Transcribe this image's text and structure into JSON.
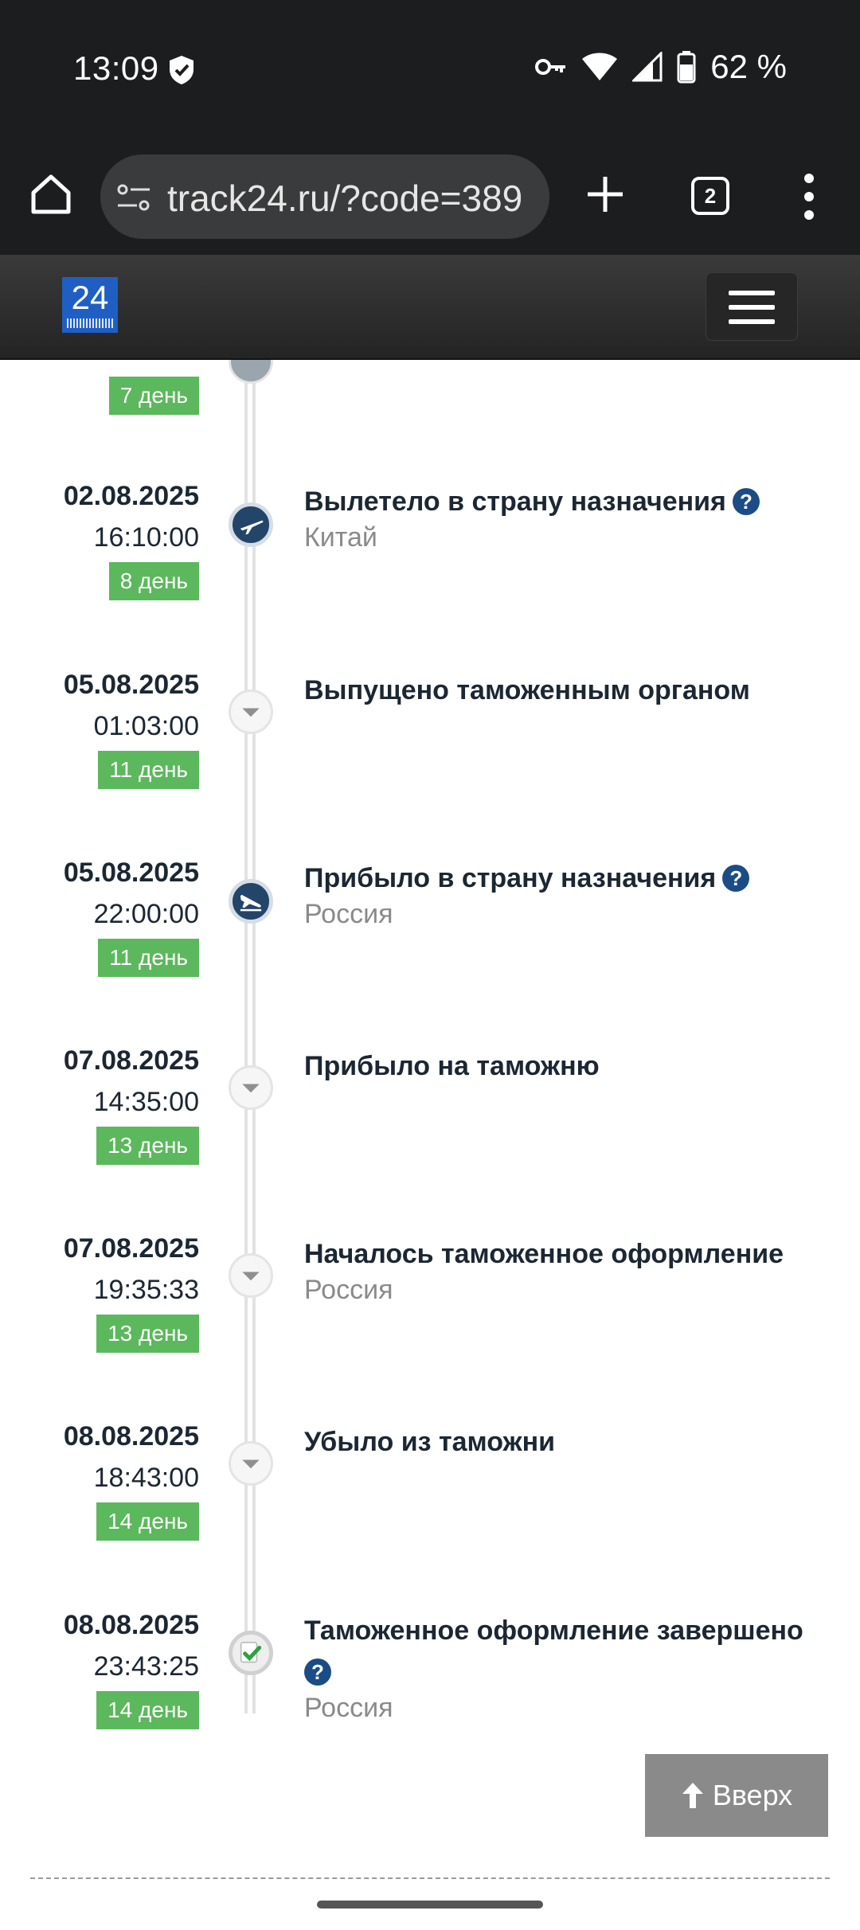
{
  "status_bar": {
    "time": "13:09",
    "battery": "62 %",
    "icons": [
      "shield-icon",
      "vpn-key-icon",
      "wifi-icon",
      "signal-icon",
      "battery-icon"
    ]
  },
  "browser": {
    "url": "track24.ru/?code=389",
    "tab_count": "2",
    "icons": [
      "home-icon",
      "site-settings-icon",
      "new-tab-icon",
      "tabs-icon",
      "overflow-menu-icon"
    ]
  },
  "site": {
    "logo_text": "24",
    "menu_icon": "hamburger-icon"
  },
  "timeline": {
    "partial_top": {
      "day": "7 день"
    },
    "events": [
      {
        "date": "02.08.2025",
        "time": "16:10:00",
        "day": "8 день",
        "title": "Вылетело в страну назначения",
        "help": "?",
        "place": "Китай",
        "icon": "plane-departure-icon"
      },
      {
        "date": "05.08.2025",
        "time": "01:03:00",
        "day": "11 день",
        "title": "Выпущено таможенным органом",
        "help": "",
        "place": "",
        "icon": "arrow-down-icon"
      },
      {
        "date": "05.08.2025",
        "time": "22:00:00",
        "day": "11 день",
        "title": "Прибыло в страну назначения",
        "help": "?",
        "place": "Россия",
        "icon": "plane-arrival-icon"
      },
      {
        "date": "07.08.2025",
        "time": "14:35:00",
        "day": "13 день",
        "title": "Прибыло на таможню",
        "help": "",
        "place": "",
        "icon": "arrow-down-icon"
      },
      {
        "date": "07.08.2025",
        "time": "19:35:33",
        "day": "13 день",
        "title": "Началось таможенное оформление",
        "help": "",
        "place": "Россия",
        "icon": "arrow-down-icon"
      },
      {
        "date": "08.08.2025",
        "time": "18:43:00",
        "day": "14 день",
        "title": "Убыло из таможни",
        "help": "",
        "place": "",
        "icon": "arrow-down-icon"
      },
      {
        "date": "08.08.2025",
        "time": "23:43:25",
        "day": "14 день",
        "title": "Таможенное оформление завершено",
        "help": "?",
        "place": "Россия",
        "icon": "check-icon"
      }
    ]
  },
  "scroll_top_button": {
    "label": "Вверх",
    "icon": "arrow-up-icon"
  }
}
